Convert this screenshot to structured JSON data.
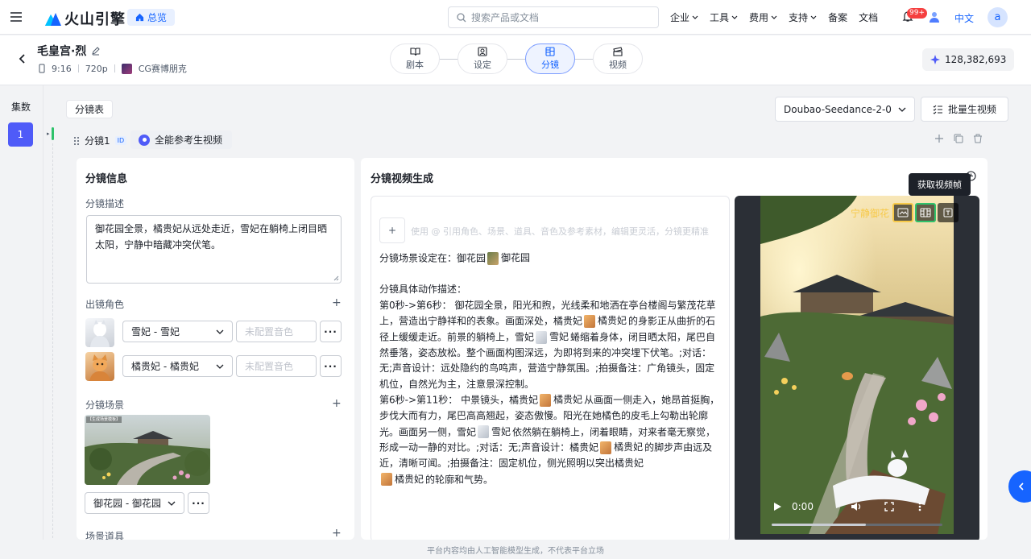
{
  "topnav": {
    "brand": "火山引擎",
    "home": "总览",
    "search_placeholder": "搜索产品或文档",
    "menu": [
      "企业",
      "工具",
      "费用",
      "支持"
    ],
    "links": [
      "备案",
      "文档"
    ],
    "badge": "99+",
    "lang": "中文",
    "avatar": "a"
  },
  "project": {
    "title": "毛皇宫·烈",
    "ratio": "9:16",
    "resolution": "720p",
    "style": "CG赛博朋克",
    "steps": [
      {
        "label": "剧本",
        "icon": "book-icon"
      },
      {
        "label": "设定",
        "icon": "settings-frame-icon"
      },
      {
        "label": "分镜",
        "icon": "storyboard-icon",
        "active": true
      },
      {
        "label": "视频",
        "icon": "video-icon"
      }
    ],
    "credits": "128,382,693"
  },
  "rail": {
    "label": "集数",
    "episode": "1"
  },
  "toolbar": {
    "tab": "分镜表",
    "model": "Doubao-Seedance-2-0",
    "batch": "批量生视频"
  },
  "shot": {
    "title": "分镜1",
    "id_tag": "ID",
    "mode": "全能参考生视频"
  },
  "info": {
    "title": "分镜信息",
    "desc_label": "分镜描述",
    "desc": "御花园全景，橘贵妃从远处走近，雪妃在躺椅上闭目晒太阳，宁静中暗藏冲突伏笔。",
    "roles_label": "出镜角色",
    "roles": [
      {
        "name": "雪妃 - 雪妃",
        "voice": "未配置音色"
      },
      {
        "name": "橘贵妃 - 橘贵妃",
        "voice": "未配置音色"
      }
    ],
    "scene_label": "分镜场景",
    "scene_caption": "【生成场景模板】",
    "scene_name": "御花园 - 御花园",
    "props_label": "场景道具"
  },
  "gen": {
    "title": "分镜视频生成",
    "add": "+",
    "placeholder": "使用 @ 引用角色、场景、道具、音色及参考素材，编辑更灵活，分镜更精准",
    "scene_prefix": "分镜场景设定在：御花园",
    "scene_chip": "御花园",
    "action_heading": "分镜具体动作描述：",
    "s1_a": "第0秒->第6秒： 御花园全景，阳光和煦，光线柔和地洒在亭台楼阁与繁茂花草上，营造出宁静祥和的表象。画面深处，橘贵妃",
    "chip_cat": "橘贵妃",
    "s1_b": "的身影正从曲折的石径上缓缓走近。前景的躺椅上，雪妃",
    "chip_snow": "雪妃",
    "s1_c": "蜷缩着身体，闭目晒太阳，尾巴自然垂落，姿态放松。整个画面构图深远，为即将到来的冲突埋下伏笔。;对话：无;声音设计：远处隐约的鸟鸣声，营造宁静氛围。;拍摄备注：广角镜头，固定机位，自然光为主，注意景深控制。",
    "s2_a": "第6秒->第11秒： 中景镜头，橘贵妃",
    "s2_b": "从画面一侧走入，她昂首挺胸，步伐大而有力，尾巴高高翘起，姿态傲慢。阳光在她橘色的皮毛上勾勒出轮廓光。画面另一侧，雪妃",
    "s2_c": "依然躺在躺椅上，闭着眼睛，对来者毫无察觉，形成一动一静的对比。;对话：无;声音设计：橘贵妃",
    "s2_d": "的脚步声由远及近，清晰可闻。;拍摄备注：固定机位，侧光照明以突出橘贵妃",
    "s2_e": "的轮廓和气势。"
  },
  "video": {
    "overlay_text": "宁静御花",
    "tooltip": "获取视频帧",
    "time": "0:00",
    "progress": 0.55
  },
  "footer": "平台内容均由人工智能模型生成，不代表平台立场"
}
